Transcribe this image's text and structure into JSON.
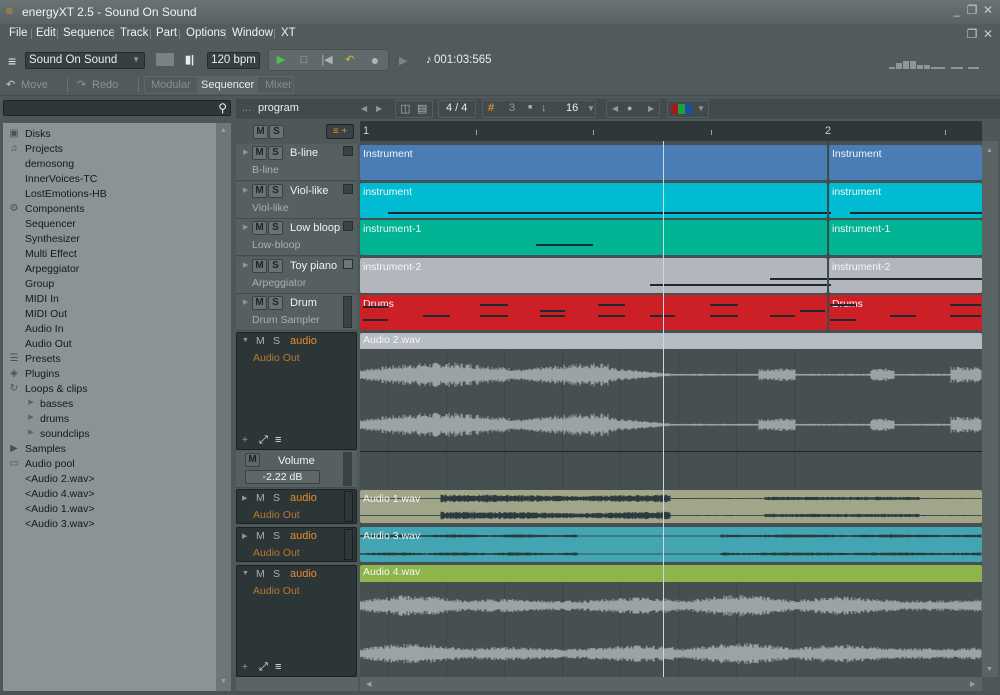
{
  "window": {
    "title": "energyXT 2.5 - Sound On Sound",
    "icon": "energyxt-logo-icon",
    "controls": [
      "minimize",
      "restore",
      "close"
    ]
  },
  "menu": [
    "File",
    "Edit",
    "Sequence",
    "Track",
    "Part",
    "Options",
    "Window",
    "XT"
  ],
  "toolbar": {
    "song": "Sound On Sound",
    "bpm": "120 bpm",
    "timecode": "001:03:565",
    "transport": [
      "play",
      "stop",
      "rewind",
      "loop",
      "record"
    ]
  },
  "toolbar2": {
    "move": "Move",
    "redo": "Redo",
    "tabs": [
      "Modular",
      "Sequencer",
      "Mixer"
    ],
    "active_tab": "Sequencer"
  },
  "browser": {
    "search_placeholder": "",
    "items": [
      {
        "label": "Disks",
        "icon": "disk-icon",
        "level": 0
      },
      {
        "label": "Projects",
        "icon": "music-note-icon",
        "level": 0
      },
      {
        "label": "demosong",
        "level": 1
      },
      {
        "label": "InnerVoices-TC",
        "level": 1
      },
      {
        "label": "LostEmotions-HB",
        "level": 1
      },
      {
        "label": "Components",
        "icon": "gear-icon",
        "level": 0
      },
      {
        "label": "Sequencer",
        "level": 1
      },
      {
        "label": "Synthesizer",
        "level": 1
      },
      {
        "label": "Multi Effect",
        "level": 1
      },
      {
        "label": "Arpeggiator",
        "level": 1
      },
      {
        "label": "Group",
        "level": 1
      },
      {
        "label": "MIDI In",
        "level": 1
      },
      {
        "label": "MIDI Out",
        "level": 1
      },
      {
        "label": "Audio In",
        "level": 1
      },
      {
        "label": "Audio Out",
        "level": 1
      },
      {
        "label": "Presets",
        "icon": "presets-icon",
        "level": 0
      },
      {
        "label": "Plugins",
        "icon": "plugin-icon",
        "level": 0
      },
      {
        "label": "Loops & clips",
        "icon": "loop-icon",
        "level": 0
      },
      {
        "label": "basses",
        "level": 2,
        "expander": true
      },
      {
        "label": "drums",
        "level": 2,
        "expander": true
      },
      {
        "label": "soundclips",
        "level": 2,
        "expander": true
      },
      {
        "label": "Samples",
        "icon": "samples-icon",
        "level": 0
      },
      {
        "label": "Audio pool",
        "icon": "folder-icon",
        "level": 0
      },
      {
        "label": "<Audio 2.wav>",
        "level": 1
      },
      {
        "label": "<Audio 4.wav>",
        "level": 1
      },
      {
        "label": "<Audio 1.wav>",
        "level": 1
      },
      {
        "label": "<Audio 3.wav>",
        "level": 1
      }
    ]
  },
  "seqbar": {
    "ellipsis": "...",
    "program": "program",
    "time_signature": "4 / 4",
    "snap_value": "3",
    "quantize": "16",
    "colors": [
      "#a01c1c",
      "#1ca03a",
      "#1c4fa0"
    ]
  },
  "ruler": {
    "bars": [
      "1",
      "2"
    ]
  },
  "tracks": [
    {
      "name": "B-line",
      "sub": "B-line",
      "clips": [
        "Instrument",
        "Instrument"
      ],
      "color": "#4a7db5"
    },
    {
      "name": "Viol-like",
      "sub": "Viol-like",
      "clips": [
        "instrument",
        "instrument"
      ],
      "color": "#00bcd2"
    },
    {
      "name": "Low bloop",
      "sub": "Low-bloop",
      "clips": [
        "instrument-1",
        "instrument-1"
      ],
      "color": "#00b494"
    },
    {
      "name": "Toy piano",
      "sub": "Arpeggiator",
      "clips": [
        "instrument-2",
        "instrument-2"
      ],
      "color": "#b3b7bd"
    },
    {
      "name": "Drum",
      "sub": "Drum Sampler",
      "clips": [
        "Drums",
        "Drums"
      ],
      "color": "#cc2026"
    }
  ],
  "audio_tracks": [
    {
      "name": "audio",
      "sub": "Audio Out",
      "clip": "Audio 2.wav",
      "color": "#b7bcc3",
      "expanded": true
    },
    {
      "name": "audio",
      "sub": "Audio Out",
      "clip": "Audio 1.wav",
      "color": "#a1a58a",
      "expanded": false
    },
    {
      "name": "audio",
      "sub": "Audio Out",
      "clip": "Audio 3.wav",
      "color": "#43a4b2",
      "expanded": false
    },
    {
      "name": "audio",
      "sub": "Audio Out",
      "clip": "Audio 4.wav",
      "color": "#8db54c",
      "expanded": true
    }
  ],
  "automation": {
    "label": "Volume",
    "value": "-2.22 dB",
    "m": "M"
  },
  "labels": {
    "m": "M",
    "s": "S"
  }
}
